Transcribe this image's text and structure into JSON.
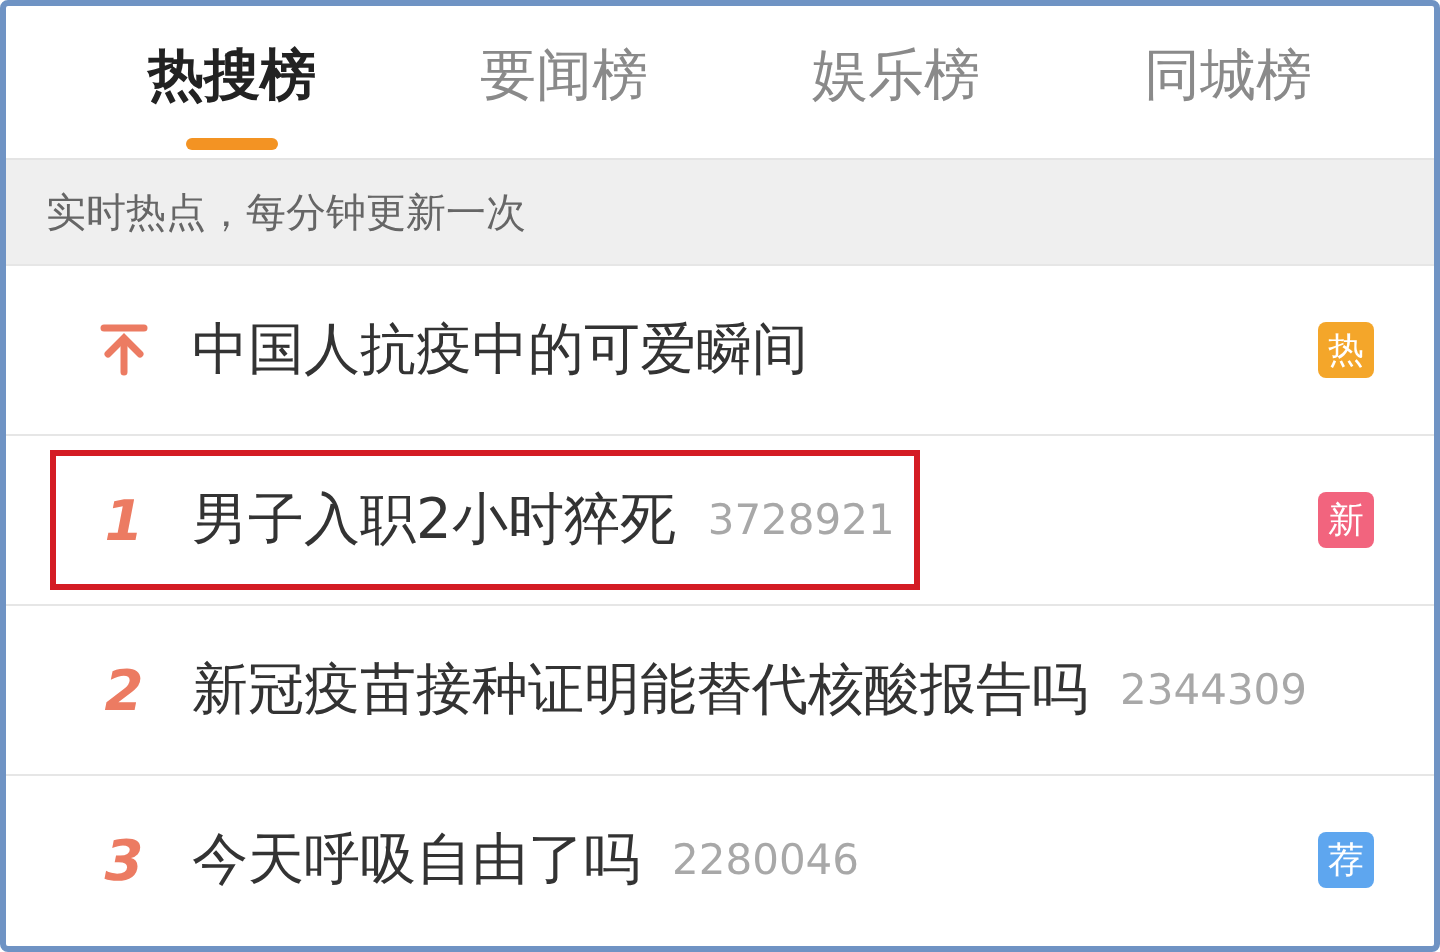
{
  "tabs": [
    {
      "label": "热搜榜",
      "selected": true
    },
    {
      "label": "要闻榜",
      "selected": false
    },
    {
      "label": "娱乐榜",
      "selected": false
    },
    {
      "label": "同城榜",
      "selected": false
    }
  ],
  "notice": "实时热点，每分钟更新一次",
  "items": [
    {
      "kind": "pinned",
      "title": "中国人抗疫中的可爱瞬间",
      "badge": "热",
      "color": "#f4a62a",
      "highlighted": false
    },
    {
      "kind": "ranked",
      "rank": "1",
      "title": "男子入职2小时猝死",
      "count": "3728921",
      "badge": "新",
      "color": "#f2647e",
      "highlighted": true
    },
    {
      "kind": "ranked",
      "rank": "2",
      "title": "新冠疫苗接种证明能替代核酸报告吗",
      "count": "2344309",
      "highlighted": false
    },
    {
      "kind": "ranked",
      "rank": "3",
      "title": "今天呼吸自由了吗",
      "count": "2280046",
      "badge": "荐",
      "color": "#5ea6ef",
      "highlighted": false
    }
  ]
}
